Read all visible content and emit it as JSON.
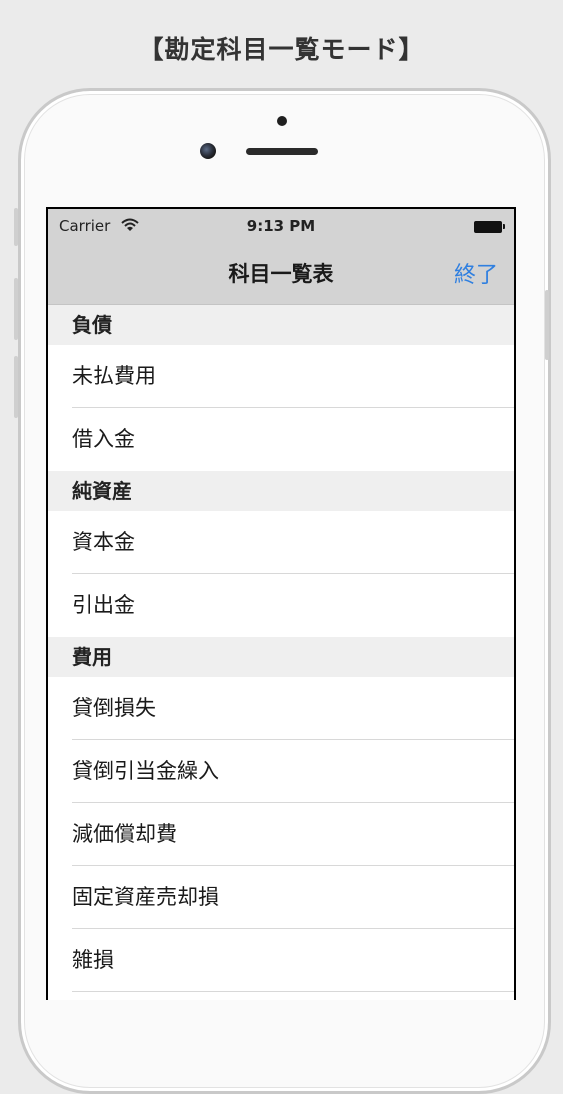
{
  "caption": "【勘定科目一覧モード】",
  "status_bar": {
    "carrier": "Carrier",
    "time": "9:13 PM",
    "wifi_icon": "wifi-icon",
    "battery_icon": "battery-icon"
  },
  "nav": {
    "title": "科目一覧表",
    "done_label": "終了"
  },
  "sections": [
    {
      "header": "負債",
      "items": [
        "未払費用",
        "借入金"
      ]
    },
    {
      "header": "純資産",
      "items": [
        "資本金",
        "引出金"
      ]
    },
    {
      "header": "費用",
      "items": [
        "貸倒損失",
        "貸倒引当金繰入",
        "減価償却費",
        "固定資産売却損",
        "雑損"
      ]
    }
  ],
  "colors": {
    "accent": "#2f7fe0",
    "bar_background": "#d3d3d3",
    "section_background": "#efefef"
  }
}
